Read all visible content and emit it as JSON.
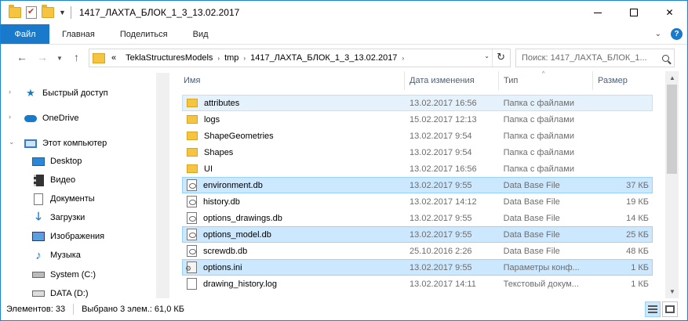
{
  "window": {
    "title": "1417_ЛАХТА_БЛОК_1_3_13.02.2017",
    "colors": {
      "accent": "#1979ca",
      "selection": "#cce8ff",
      "border": "#1883d7"
    }
  },
  "ribbon": {
    "tabs": [
      "Файл",
      "Главная",
      "Поделиться",
      "Вид"
    ]
  },
  "address": {
    "prefix": "«",
    "crumbs": [
      "TeklaStructuresModels",
      "tmp",
      "1417_ЛАХТА_БЛОК_1_3_13.02.2017"
    ]
  },
  "search": {
    "placeholder": "Поиск: 1417_ЛАХТА_БЛОК_1..."
  },
  "sidebar": {
    "items": [
      {
        "label": "Быстрый доступ",
        "icon": "star-icon"
      },
      {
        "label": "OneDrive",
        "icon": "cloud-icon"
      },
      {
        "label": "Этот компьютер",
        "icon": "computer-icon"
      },
      {
        "label": "Desktop",
        "icon": "desktop-icon"
      },
      {
        "label": "Видео",
        "icon": "video-icon"
      },
      {
        "label": "Документы",
        "icon": "documents-icon"
      },
      {
        "label": "Загрузки",
        "icon": "download-icon"
      },
      {
        "label": "Изображения",
        "icon": "pictures-icon"
      },
      {
        "label": "Музыка",
        "icon": "music-icon"
      },
      {
        "label": "System (C:)",
        "icon": "drive-icon"
      },
      {
        "label": "DATA (D:)",
        "icon": "drive-icon"
      }
    ]
  },
  "columns": {
    "name": "Имя",
    "date": "Дата изменения",
    "type": "Тип",
    "size": "Размер"
  },
  "files": [
    {
      "name": "attributes",
      "date": "13.02.2017 16:56",
      "type": "Папка с файлами",
      "size": "",
      "kind": "folder",
      "state": "selected"
    },
    {
      "name": "logs",
      "date": "15.02.2017 12:13",
      "type": "Папка с файлами",
      "size": "",
      "kind": "folder",
      "state": ""
    },
    {
      "name": "ShapeGeometries",
      "date": "13.02.2017 9:54",
      "type": "Папка с файлами",
      "size": "",
      "kind": "folder",
      "state": ""
    },
    {
      "name": "Shapes",
      "date": "13.02.2017 9:54",
      "type": "Папка с файлами",
      "size": "",
      "kind": "folder",
      "state": ""
    },
    {
      "name": "UI",
      "date": "13.02.2017 16:56",
      "type": "Папка с файлами",
      "size": "",
      "kind": "folder",
      "state": ""
    },
    {
      "name": "environment.db",
      "date": "13.02.2017 9:55",
      "type": "Data Base File",
      "size": "37 КБ",
      "kind": "db",
      "state": "focus"
    },
    {
      "name": "history.db",
      "date": "13.02.2017 14:12",
      "type": "Data Base File",
      "size": "19 КБ",
      "kind": "db",
      "state": ""
    },
    {
      "name": "options_drawings.db",
      "date": "13.02.2017 9:55",
      "type": "Data Base File",
      "size": "14 КБ",
      "kind": "db",
      "state": ""
    },
    {
      "name": "options_model.db",
      "date": "13.02.2017 9:55",
      "type": "Data Base File",
      "size": "25 КБ",
      "kind": "db",
      "state": "focus"
    },
    {
      "name": "screwdb.db",
      "date": "25.10.2016 2:26",
      "type": "Data Base File",
      "size": "48 КБ",
      "kind": "db",
      "state": ""
    },
    {
      "name": "options.ini",
      "date": "13.02.2017 9:55",
      "type": "Параметры конф...",
      "size": "1 КБ",
      "kind": "ini",
      "state": "focus"
    },
    {
      "name": "drawing_history.log",
      "date": "13.02.2017 14:11",
      "type": "Текстовый докум...",
      "size": "1 КБ",
      "kind": "txt",
      "state": ""
    }
  ],
  "status": {
    "count": "Элементов: 33",
    "selected": "Выбрано 3 элем.: 61,0 КБ"
  }
}
